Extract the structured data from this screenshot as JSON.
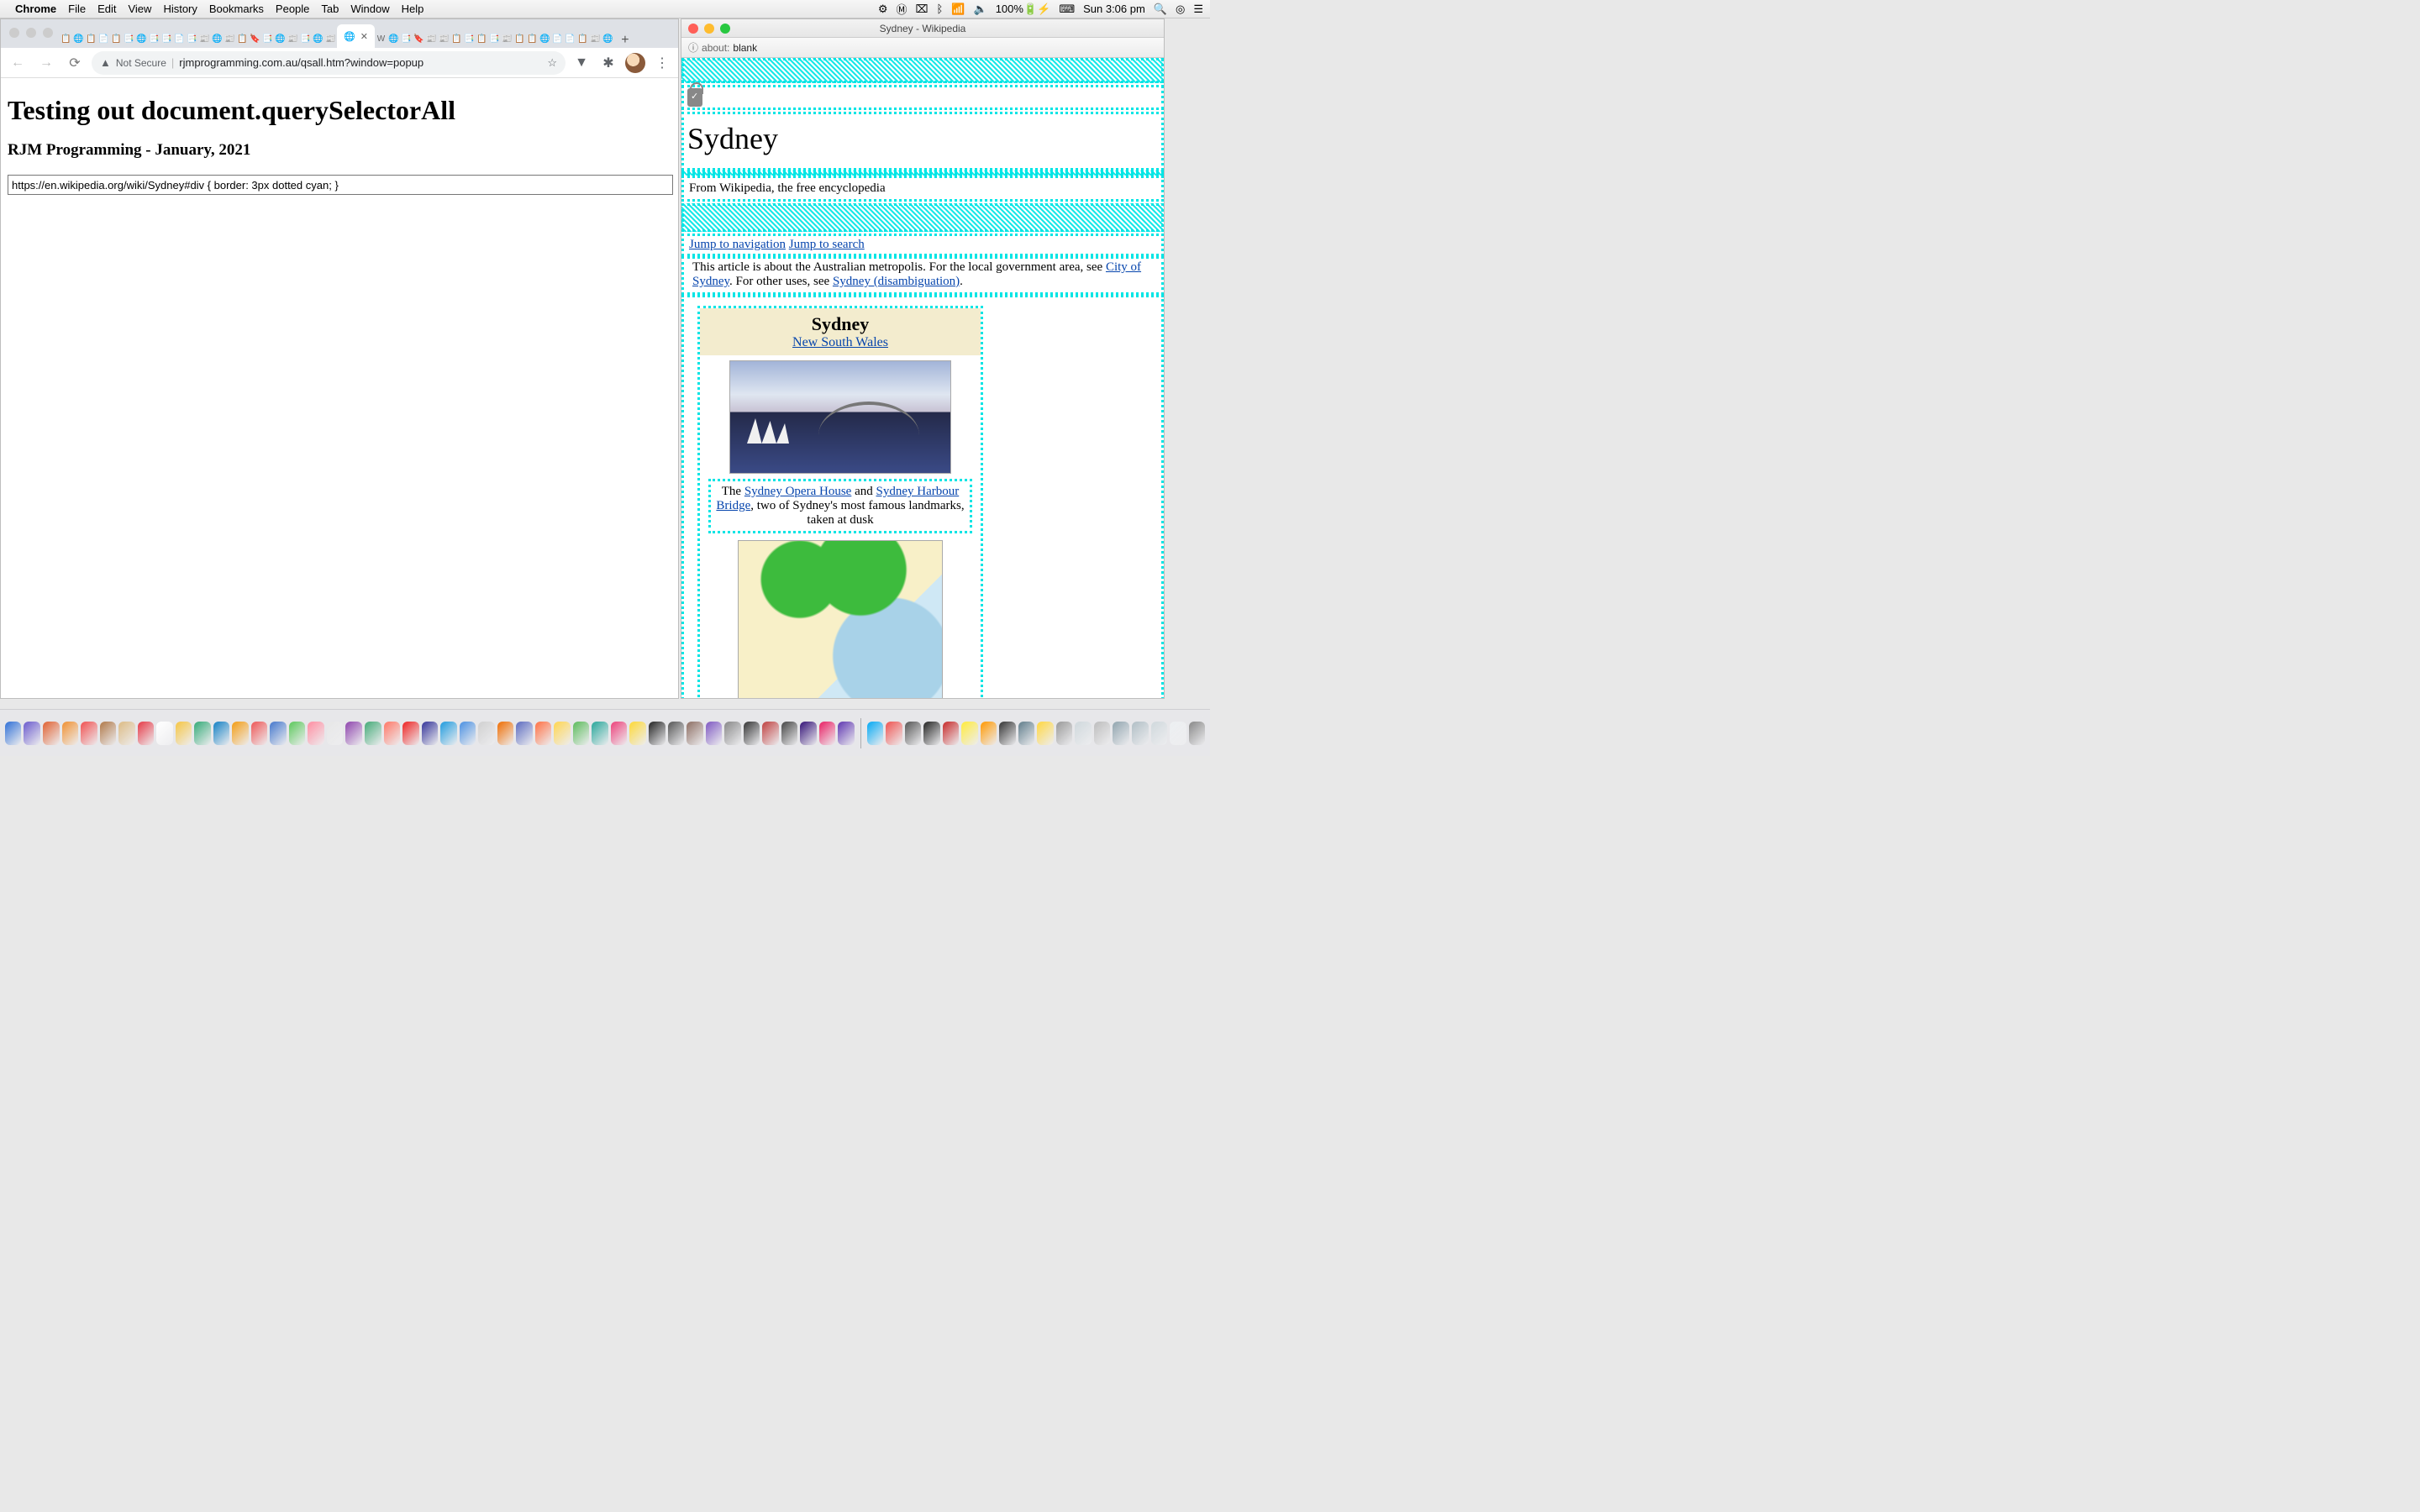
{
  "menubar": {
    "app": "Chrome",
    "items": [
      "File",
      "Edit",
      "View",
      "History",
      "Bookmarks",
      "People",
      "Tab",
      "Window",
      "Help"
    ],
    "battery": "100%",
    "clock": "Sun 3:06 pm"
  },
  "chrome": {
    "toolbar": {
      "not_secure": "Not Secure",
      "url": "rjmprogramming.com.au/qsall.htm?window=popup"
    },
    "new_tab_plus": "+"
  },
  "page": {
    "h1": "Testing out document.querySelectorAll",
    "h2": "RJM Programming - January, 2021",
    "input_value": "https://en.wikipedia.org/wiki/Sydney#div { border: 3px dotted cyan; }"
  },
  "safari": {
    "title": "Sydney - Wikipedia",
    "addr_prefix": "about:",
    "addr_rest": "blank"
  },
  "wiki": {
    "heading": "Sydney",
    "tagline": "From Wikipedia, the free encyclopedia",
    "jump_nav": "Jump to navigation",
    "jump_search": "Jump to search",
    "disamb_pre": "This article is about the Australian metropolis. For the local government area, see ",
    "disamb_link1": "City of Sydney",
    "disamb_mid": ". For other uses, see ",
    "disamb_link2": "Sydney (disambiguation)",
    "disamb_end": ".",
    "infobox_title": "Sydney",
    "infobox_state": "New South Wales",
    "caption_pre": "The ",
    "caption_l1": "Sydney Opera House",
    "caption_mid1": " and ",
    "caption_l2": "Sydney Harbour Bridge",
    "caption_post": ", two of Sydney's most famous landmarks, taken at dusk"
  },
  "dock_colors": [
    "#2e6fd6",
    "#6a5acd",
    "#e06030",
    "#f09030",
    "#f05050",
    "#b07848",
    "#dcbb84",
    "#e63946",
    "#ffffff",
    "#f5c542",
    "#3a7",
    "#1380c4",
    "#f39c12",
    "#e55",
    "#47c",
    "#5bc85b",
    "#ff8da1",
    "#e7e7e7",
    "#8e44ad",
    "#4a7",
    "#f76",
    "#e22",
    "#339",
    "#1f9bde",
    "#4a90e2",
    "#d0d0d0",
    "#ef6c00",
    "#5c6bc0",
    "#ff7043",
    "#ffd54f",
    "#5bbb5b",
    "#26a69a",
    "#ec407a",
    "#fdd835",
    "#222",
    "#555",
    "#8d6e63",
    "#7e57c2",
    "#888",
    "#333",
    "#bf4040",
    "#444",
    "#331177",
    "#e91e63",
    "#5e35b1",
    "#03a9f4",
    "#ef5350",
    "#555",
    "#222",
    "#c62828",
    "#ffeb3b",
    "#ff9800",
    "#333",
    "#607d8b",
    "#ffd740",
    "#999999",
    "#cfd8dc",
    "#bdbdbd",
    "#90a4ae",
    "#b0bec5",
    "#cfd8dc",
    "#eceff1",
    "#888"
  ]
}
